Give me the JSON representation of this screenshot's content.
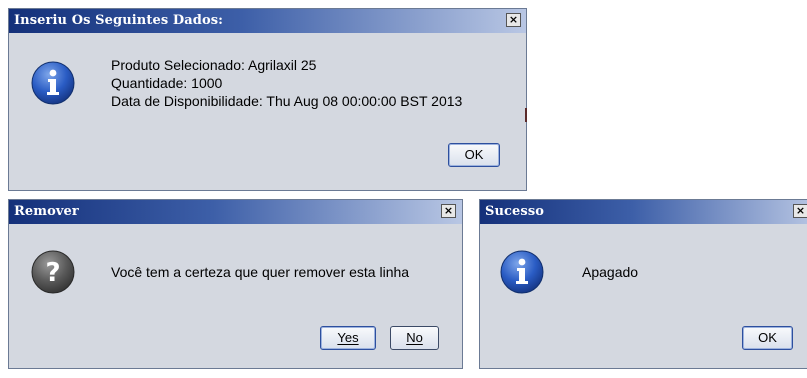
{
  "dialogs": {
    "info": {
      "title": "Inseriu Os Seguintes Dados:",
      "close_glyph": "×",
      "icon": "info-icon",
      "lines": [
        "Produto Selecionado: Agrilaxil 25",
        "Quantidade: 1000",
        "Data de Disponibilidade: Thu Aug 08 00:00:00 BST 2013"
      ],
      "ok_label": "OK"
    },
    "remove": {
      "title": "Remover",
      "close_glyph": "×",
      "icon": "question-icon",
      "message": "Você tem a certeza que quer remover esta linha",
      "yes_label": "Yes",
      "no_label": "No"
    },
    "success": {
      "title": "Sucesso",
      "close_glyph": "×",
      "icon": "info-icon",
      "message": "Apagado",
      "ok_label": "OK"
    }
  },
  "colors": {
    "title_gradient_start": "#14307a",
    "dialog_background": "#d4d8e0"
  }
}
